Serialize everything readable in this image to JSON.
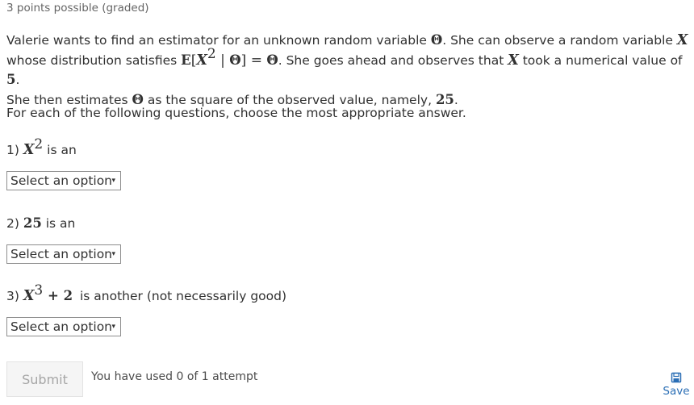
{
  "header": {
    "points": "3 points possible (graded)"
  },
  "prompt": {
    "line1_text": "Valerie wants to find an estimator for an unknown random variable ",
    "theta": "Θ",
    "line1_text2": ". She can observe a random variable ",
    "X": "X",
    "line2_text": "whose distribution satisfies ",
    "E": "E",
    "exp_open": "[",
    "sq": "2",
    "given": " | ",
    "exp_close": "] = ",
    "line2_text2": ". She goes ahead and observes that ",
    "line2_text3": " took a numerical value of ",
    "five": "5",
    "period": ".",
    "line3_text": "She then estimates ",
    "line3_text2": " as the square of the observed value, namely, ",
    "twentyfive": "25",
    "instruction": "For each of the following questions, choose the most appropriate answer."
  },
  "questions": [
    {
      "prefix": "1) ",
      "math_base": "X",
      "math_sup": "2",
      "suffix": " is an"
    },
    {
      "prefix": "2) ",
      "math_bold": "25",
      "suffix": " is an"
    },
    {
      "prefix": "3) ",
      "math_base": "X",
      "math_sup": "3",
      "math_plus": " + 2",
      "suffix": " is another (not necessarily good)"
    }
  ],
  "select": {
    "placeholder": "Select an option",
    "arrow": "▾"
  },
  "footer": {
    "submit_label": "Submit",
    "attempts_text": "You have used 0 of 1 attempt",
    "save_label": "Save",
    "save_icon": "save-icon"
  }
}
